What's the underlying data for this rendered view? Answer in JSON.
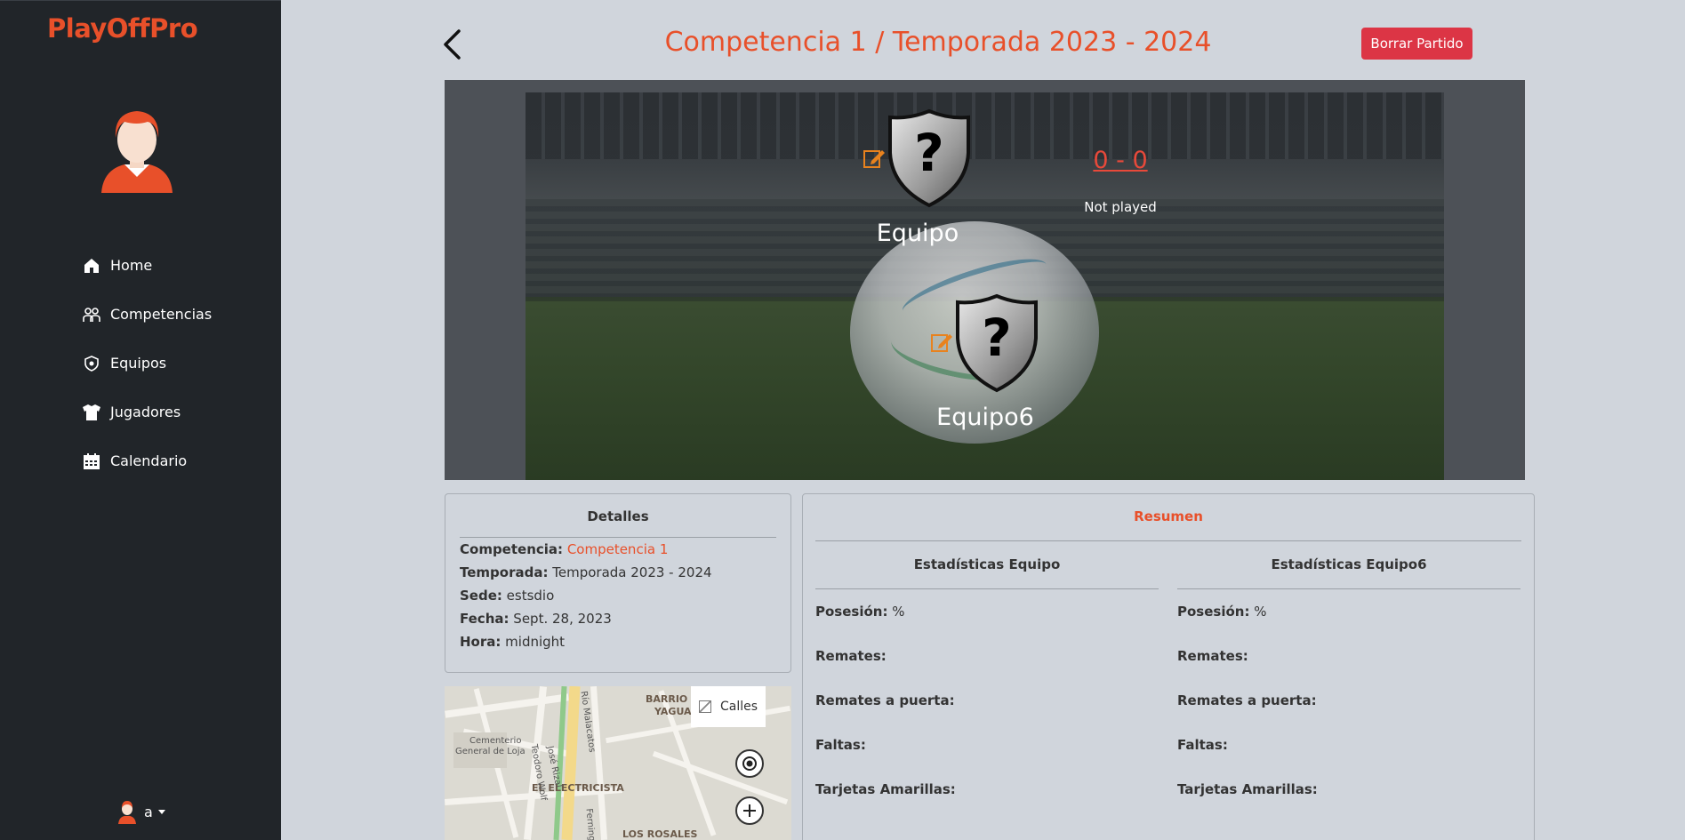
{
  "sidebar": {
    "brand": "PlayOffPro",
    "items": [
      {
        "label": "Home",
        "icon": "home-icon"
      },
      {
        "label": "Competencias",
        "icon": "competitions-icon"
      },
      {
        "label": "Equipos",
        "icon": "teams-icon"
      },
      {
        "label": "Jugadores",
        "icon": "players-icon"
      },
      {
        "label": "Calendario",
        "icon": "calendar-icon"
      }
    ],
    "user": "a"
  },
  "header": {
    "title": "Competencia 1 / Temporada 2023 - 2024",
    "delete_label": "Borrar Partido"
  },
  "match": {
    "home_team": "Equipo",
    "away_team": "Equipo6",
    "score": "0 - 0",
    "status": "Not played"
  },
  "details": {
    "title": "Detalles",
    "competencia_label": "Competencia:",
    "competencia_value": "Competencia 1",
    "temporada_label": "Temporada:",
    "temporada_value": "Temporada 2023 - 2024",
    "sede_label": "Sede:",
    "sede_value": "estsdio",
    "fecha_label": "Fecha:",
    "fecha_value": "Sept. 28, 2023",
    "hora_label": "Hora:",
    "hora_value": "midnight"
  },
  "map": {
    "layer_label": "Calles",
    "labels": [
      "BARRIO",
      "YAGUARCUNA",
      "Cementerio",
      "General de Loja",
      "EL ELECTRICISTA",
      "LOS ROSALES",
      "Teodoro Wolf",
      "José Rizal",
      "Río Malacatos",
      "Ferning"
    ]
  },
  "summary": {
    "title": "Resumen",
    "home_heading": "Estadísticas Equipo",
    "away_heading": "Estadísticas Equipo6",
    "stats": [
      {
        "label": "Posesión:",
        "home": "%",
        "away": "%"
      },
      {
        "label": "Remates:",
        "home": "",
        "away": ""
      },
      {
        "label": "Remates a puerta:",
        "home": "",
        "away": ""
      },
      {
        "label": "Faltas:",
        "home": "",
        "away": ""
      },
      {
        "label": "Tarjetas Amarillas:",
        "home": "",
        "away": ""
      }
    ]
  },
  "colors": {
    "accent": "#e8502a",
    "danger": "#dc3545",
    "sidebar_bg": "#212529",
    "page_bg": "#d0d5dc"
  }
}
